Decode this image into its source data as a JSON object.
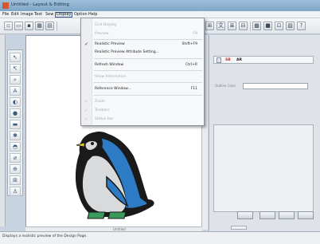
{
  "window": {
    "title": "Untitled - Layout & Editing"
  },
  "menubar": {
    "items": [
      "File",
      "Edit",
      "Image",
      "Text",
      "Sew",
      "Display",
      "Option",
      "Help"
    ],
    "active_index": 5
  },
  "display_menu": {
    "items": [
      {
        "label": "Grid Display",
        "shortcut": "",
        "enabled": false,
        "checked": false
      },
      {
        "label": "Preview",
        "shortcut": "F9",
        "enabled": false,
        "checked": false
      },
      {
        "label": "Realistic Preview",
        "shortcut": "Shift+F9",
        "enabled": true,
        "checked": true
      },
      {
        "label": "Realistic Preview Attribute Setting...",
        "shortcut": "",
        "enabled": true,
        "checked": false
      },
      {
        "label": "Refresh Window",
        "shortcut": "Ctrl+R",
        "enabled": true,
        "checked": false
      },
      {
        "label": "Show Information",
        "shortcut": "",
        "enabled": false,
        "checked": false
      },
      {
        "label": "Reference Window...",
        "shortcut": "F11",
        "enabled": true,
        "checked": false
      },
      {
        "label": "Zoom",
        "shortcut": "",
        "enabled": false,
        "checked": true
      },
      {
        "label": "Toolbars",
        "shortcut": "",
        "enabled": false,
        "checked": true
      },
      {
        "label": "Status bar",
        "shortcut": "",
        "enabled": false,
        "checked": true
      }
    ]
  },
  "canvas": {
    "page_label": "Untitled"
  },
  "right_panel": {
    "tabs": [
      "SB",
      "AR"
    ],
    "field_label": "Outline Color"
  },
  "statusbar": {
    "text": "Displays a realistic preview of the Design Page."
  },
  "colors": {
    "penguin_blue": "#2c7bc4",
    "penguin_black": "#1a1a1a",
    "penguin_white": "#d9dadb",
    "beak_yellow": "#e8d22a",
    "feet_green": "#3a9a5b"
  }
}
